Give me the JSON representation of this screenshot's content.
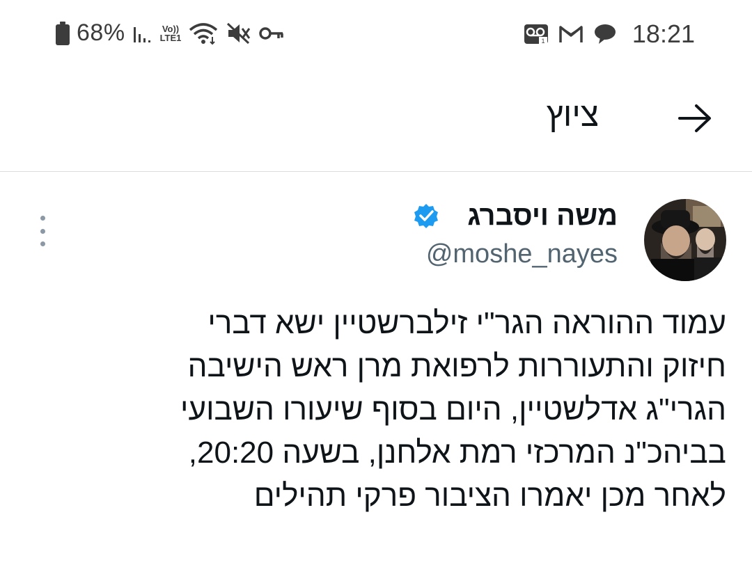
{
  "status_bar": {
    "battery": "68%",
    "network": "Vo)) LTE1",
    "time": "18:21",
    "icons_left": [
      "battery-icon",
      "signal-icon",
      "lte-icon",
      "wifi-icon",
      "mute-icon",
      "key-icon"
    ],
    "icons_right": [
      "voicemail-icon",
      "gmail-icon",
      "chat-bubble-icon"
    ]
  },
  "header": {
    "title": "ציוץ",
    "back_icon": "arrow-right-icon"
  },
  "tweet": {
    "author_name": "משה ויסברג",
    "handle": "@moshe_nayes",
    "verified": true,
    "lines": [
      "עמוד ההוראה הגר\"י זילברשטיין ישא דברי",
      "חיזוק והתעוררות לרפואת מרן ראש הישיבה",
      "הגרי\"ג אדלשטיין, היום בסוף שיעורו השבועי",
      "בביהכ\"נ המרכזי רמת אלחנן, בשעה 20:20,",
      "לאחר מכן יאמרו הציבור פרקי תהילים"
    ]
  },
  "colors": {
    "text": "#0f1419",
    "secondary": "#536471",
    "verified": "#1d9bf0",
    "divider": "#dcdcdc"
  }
}
